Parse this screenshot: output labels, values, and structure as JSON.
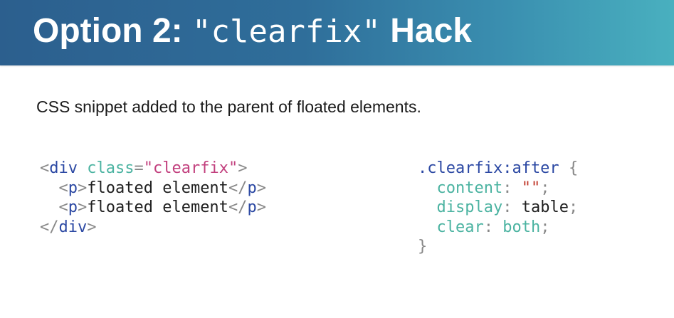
{
  "header": {
    "title_prefix": "Option 2:",
    "title_code": "\"clearfix\"",
    "title_suffix": "Hack"
  },
  "subtitle": "CSS snippet added to the parent of floated elements.",
  "html_snippet": {
    "line1": {
      "open": "<",
      "tag": "div",
      "attr": "class",
      "eq": "=",
      "value": "\"clearfix\"",
      "close": ">"
    },
    "line2": {
      "open": "<",
      "tag": "p",
      "close": ">",
      "text": "floated element",
      "end_open": "</",
      "end_tag": "p",
      "end_close": ">"
    },
    "line3": {
      "open": "<",
      "tag": "p",
      "close": ">",
      "text": "floated element",
      "end_open": "</",
      "end_tag": "p",
      "end_close": ">"
    },
    "line4": {
      "open": "</",
      "tag": "div",
      "close": ">"
    }
  },
  "css_snippet": {
    "selector": ".clearfix:after",
    "open_brace": "{",
    "close_brace": "}",
    "rules": [
      {
        "property": "content",
        "colon": ":",
        "value": "\"\"",
        "semi": ";"
      },
      {
        "property": "display",
        "colon": ":",
        "value": "table",
        "semi": ";"
      },
      {
        "property": "clear",
        "colon": ":",
        "value": "both",
        "semi": ";"
      }
    ]
  },
  "colors": {
    "header_gradient_start": "#2c5f8e",
    "header_gradient_end": "#49b0bf",
    "tag": "#2b48a3",
    "punctuation": "#888888",
    "attribute": "#4bb3a1",
    "string": "#c2407e",
    "text": "#1f1f1f"
  }
}
